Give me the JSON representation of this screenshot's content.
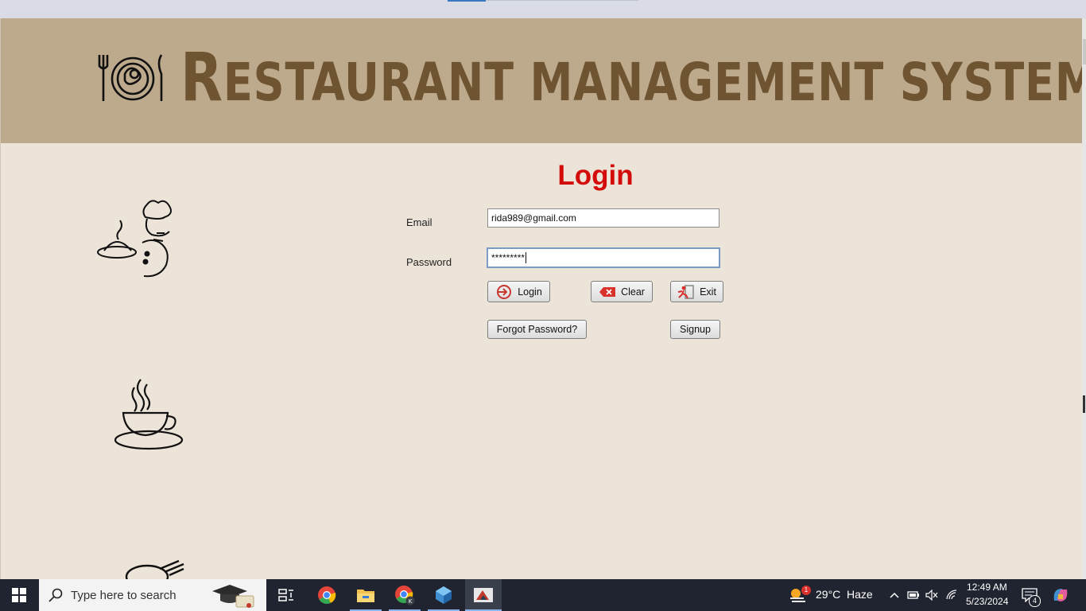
{
  "app": {
    "banner_title_first": "R",
    "banner_title_rest": "ESTAURANT MANAGEMENT SYSTEM",
    "login_heading": "Login",
    "email_label": "Email",
    "email_value": "rida989@gmail.com",
    "password_label": "Password",
    "password_value": "*********",
    "buttons": {
      "login": "Login",
      "clear": "Clear",
      "exit": "Exit",
      "forgot": "Forgot Password?",
      "signup": "Signup"
    },
    "colors": {
      "banner": "#bda98c",
      "title": "#6f5431",
      "background": "#ece4d8",
      "login_heading": "#d30b0b"
    }
  },
  "taskbar": {
    "search_placeholder": "Type here to search",
    "weather_temp": "29°C",
    "weather_desc": "Haze",
    "weather_badge": "1",
    "time": "12:49 AM",
    "date": "5/23/2024",
    "notification_count": "4",
    "icons": [
      "windows-start-icon",
      "search-icon",
      "task-view-icon",
      "chrome-icon",
      "file-explorer-icon",
      "chrome-profile-icon",
      "netbeans-icon",
      "java-app-icon"
    ]
  }
}
